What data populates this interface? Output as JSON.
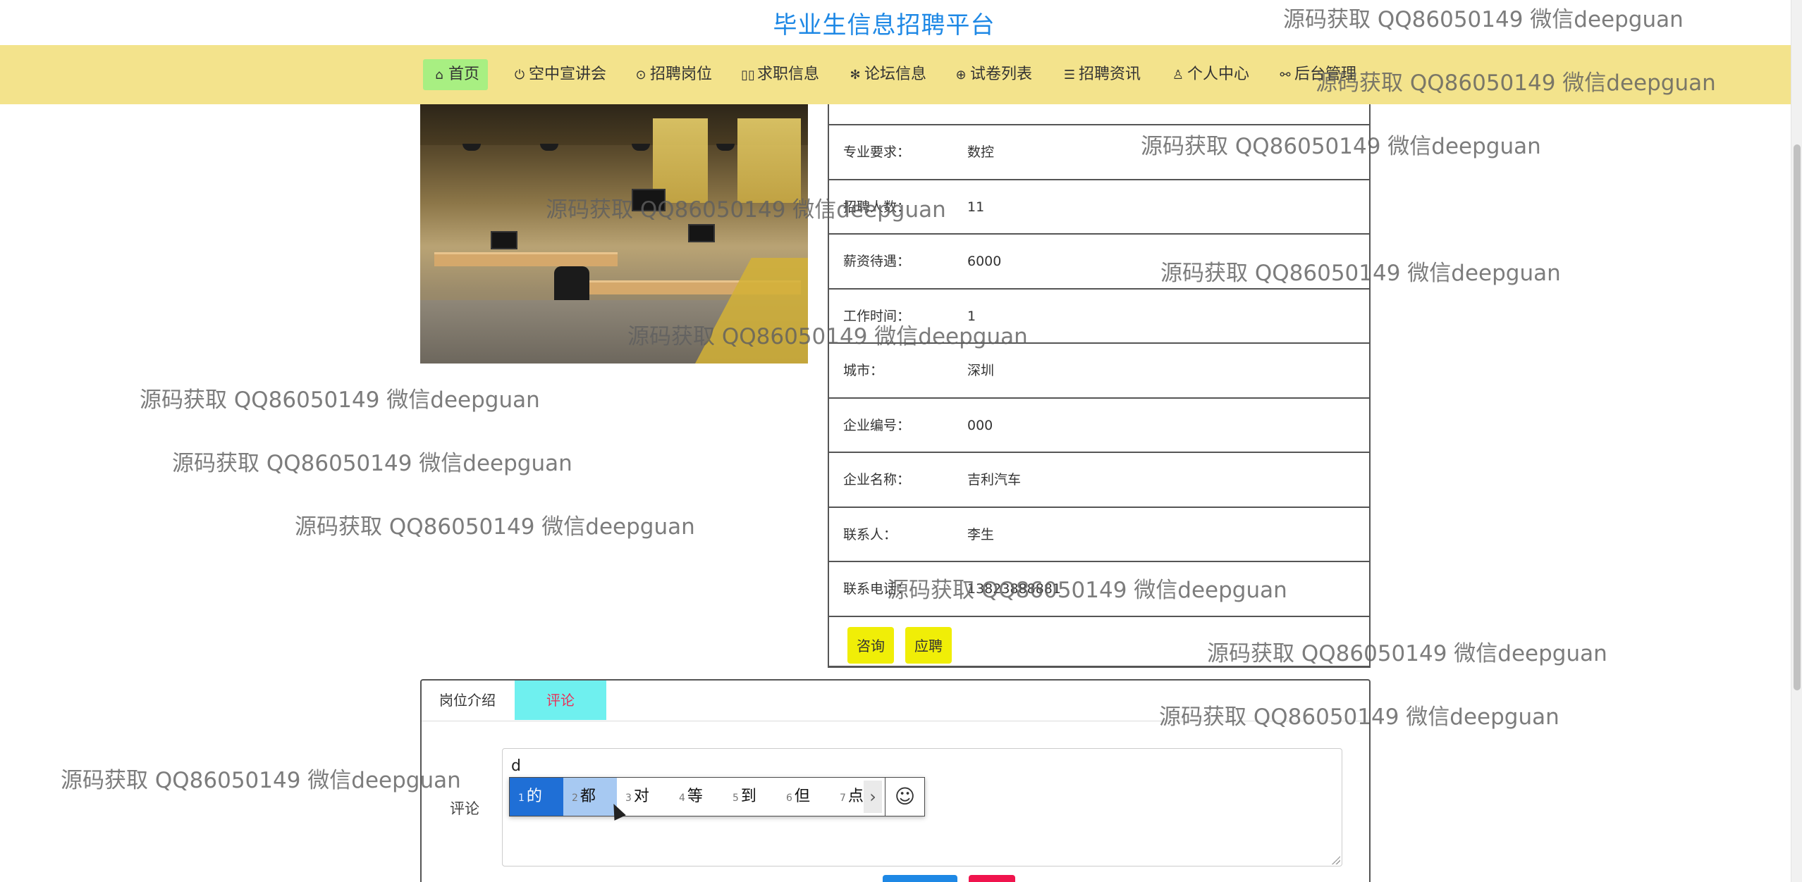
{
  "site": {
    "title": "毕业生信息招聘平台"
  },
  "nav": {
    "items": [
      {
        "label": "首页",
        "icon": "home-icon",
        "glyph": "⌂"
      },
      {
        "label": "空中宣讲会",
        "icon": "power-icon",
        "glyph": "⏻"
      },
      {
        "label": "招聘岗位",
        "icon": "target-icon",
        "glyph": "⊙"
      },
      {
        "label": "求职信息",
        "icon": "book-icon",
        "glyph": "▯▯"
      },
      {
        "label": "论坛信息",
        "icon": "asterisk-icon",
        "glyph": "✻"
      },
      {
        "label": "试卷列表",
        "icon": "globe-icon",
        "glyph": "⊕"
      },
      {
        "label": "招聘资讯",
        "icon": "sliders-icon",
        "glyph": "☰"
      },
      {
        "label": "个人中心",
        "icon": "user-icon",
        "glyph": "♙"
      },
      {
        "label": "后台管理",
        "icon": "link-icon",
        "glyph": "⚯"
      }
    ],
    "active_color": "#a8ef82",
    "bar_color": "#f3e38c"
  },
  "details": {
    "rows": [
      {
        "label": "专业要求：",
        "value": "数控"
      },
      {
        "label": "招聘人数：",
        "value": "11"
      },
      {
        "label": "薪资待遇：",
        "value": "6000"
      },
      {
        "label": "工作时间：",
        "value": "1"
      },
      {
        "label": "城市：",
        "value": "深圳"
      },
      {
        "label": "企业编号：",
        "value": "000"
      },
      {
        "label": "企业名称：",
        "value": "吉利汽车"
      },
      {
        "label": "联系人：",
        "value": "李生"
      },
      {
        "label": "联系电话：",
        "value": "13823888881"
      }
    ],
    "buttons": {
      "consult": "咨询",
      "apply": "应聘"
    },
    "button_color": "#f0ee07"
  },
  "tabs": {
    "items": [
      {
        "label": "岗位介绍"
      },
      {
        "label": "评论"
      }
    ],
    "active_color": "#6ff0ef"
  },
  "comment": {
    "label": "评论",
    "input_value": "d"
  },
  "ime": {
    "candidates": [
      {
        "num": "1",
        "text": "的"
      },
      {
        "num": "2",
        "text": "都"
      },
      {
        "num": "3",
        "text": "对"
      },
      {
        "num": "4",
        "text": "等"
      },
      {
        "num": "5",
        "text": "到"
      },
      {
        "num": "6",
        "text": "但"
      },
      {
        "num": "7",
        "text": "点"
      }
    ],
    "next_glyph": "›",
    "emoji_glyph": "☺"
  },
  "watermark": {
    "text": "源码获取 QQ86050149 微信deepguan"
  }
}
